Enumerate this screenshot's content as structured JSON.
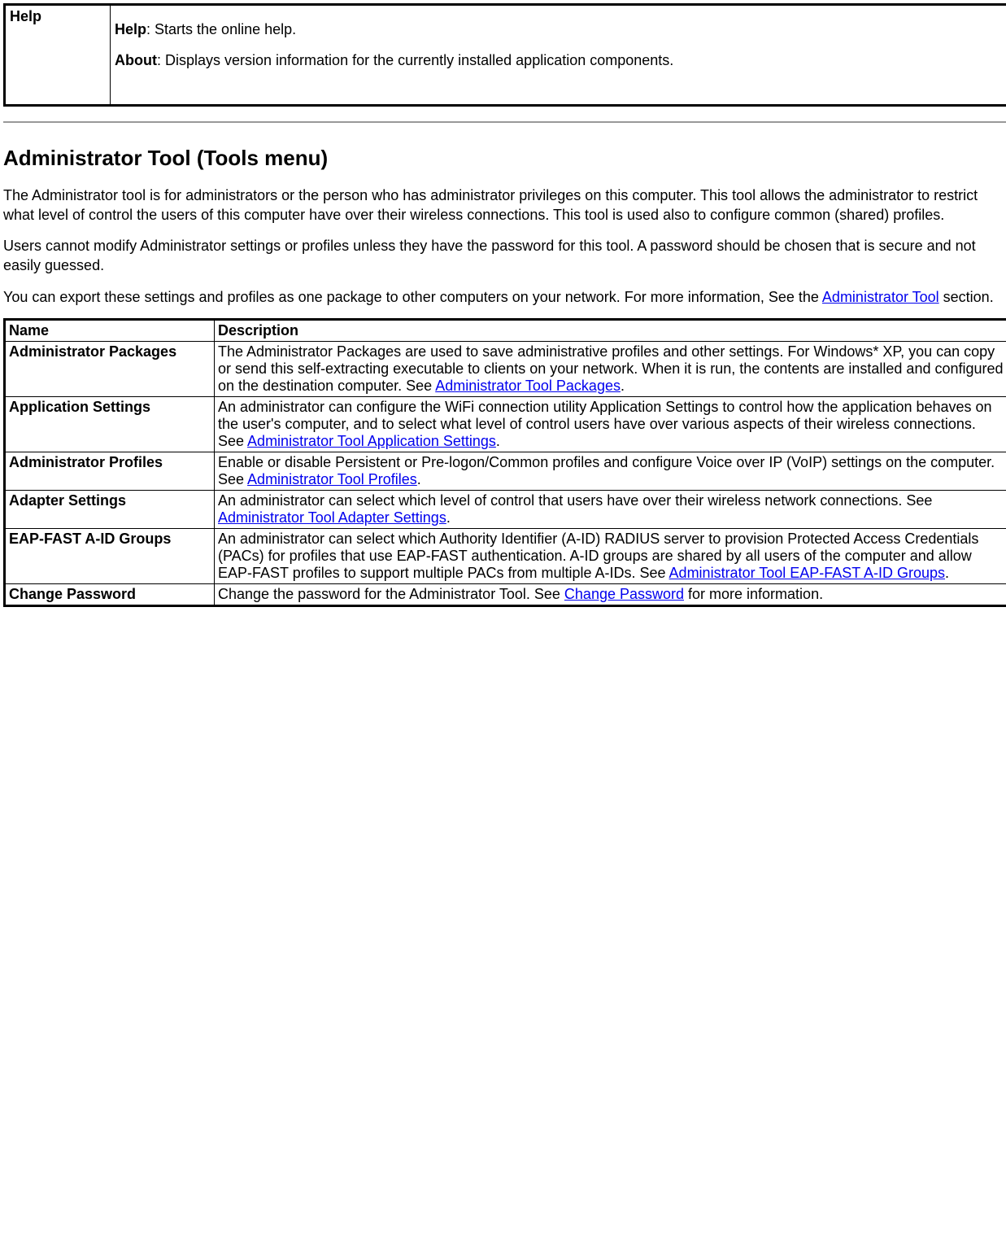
{
  "table1": {
    "row": {
      "col1": "Help",
      "para1_bold": "Help",
      "para1_rest": ": Starts the online help.",
      "para2_bold": "About",
      "para2_rest": ": Displays version information for the currently installed application components."
    }
  },
  "heading": "Administrator Tool (Tools menu)",
  "para1": "The Administrator tool is for administrators or the person who has administrator privileges on this computer. This tool allows the administrator to restrict what level of control the users of this computer have over their wireless connections. This tool is used also to configure common (shared) profiles.",
  "para2": "Users cannot modify Administrator settings or profiles unless they have the password for this tool. A password should be chosen that is secure and not easily guessed.",
  "para3_a": "You can export these settings and profiles as one package to other computers on your network. For more information, See the ",
  "para3_link": "Administrator Tool",
  "para3_b": " section.",
  "table2": {
    "header": {
      "c1": "Name",
      "c2": "Description"
    },
    "rows": [
      {
        "name": "Administrator Packages",
        "desc_a": "The Administrator Packages are used to save administrative profiles and other settings. For Windows* XP, you can copy or send this self-extracting executable to clients on your network. When it is run, the contents are installed and configured on the destination computer. See ",
        "link": "Administrator Tool Packages",
        "desc_b": "."
      },
      {
        "name": "Application Settings",
        "desc_a": "An administrator can configure the WiFi connection utility Application Settings to control how the application behaves on the user's computer, and to select what level of control users have over various aspects of their wireless connections. See ",
        "link": "Administrator Tool Application Settings",
        "desc_b": "."
      },
      {
        "name": "Administrator Profiles",
        "desc_a": "Enable or disable Persistent or Pre-logon/Common profiles and configure Voice over IP (VoIP) settings on the computer. See ",
        "link": "Administrator Tool Profiles",
        "desc_b": "."
      },
      {
        "name": "Adapter Settings",
        "desc_a": "An administrator can select which level of control that users have over their wireless network connections. See ",
        "link": "Administrator Tool Adapter Settings",
        "desc_b": "."
      },
      {
        "name": "EAP-FAST A-ID Groups",
        "desc_a": "An administrator can select which Authority Identifier (A-ID) RADIUS server to provision Protected Access Credentials (PACs) for profiles that use EAP-FAST authentication. A-ID groups are shared by all users of the computer and allow EAP-FAST profiles to support multiple PACs from multiple A-IDs. See ",
        "link": "Administrator Tool EAP-FAST A-ID Groups",
        "desc_b": "."
      },
      {
        "name": "Change Password",
        "desc_a": "Change the password for the Administrator Tool. See ",
        "link": "Change Password",
        "desc_b": " for more information."
      }
    ]
  }
}
